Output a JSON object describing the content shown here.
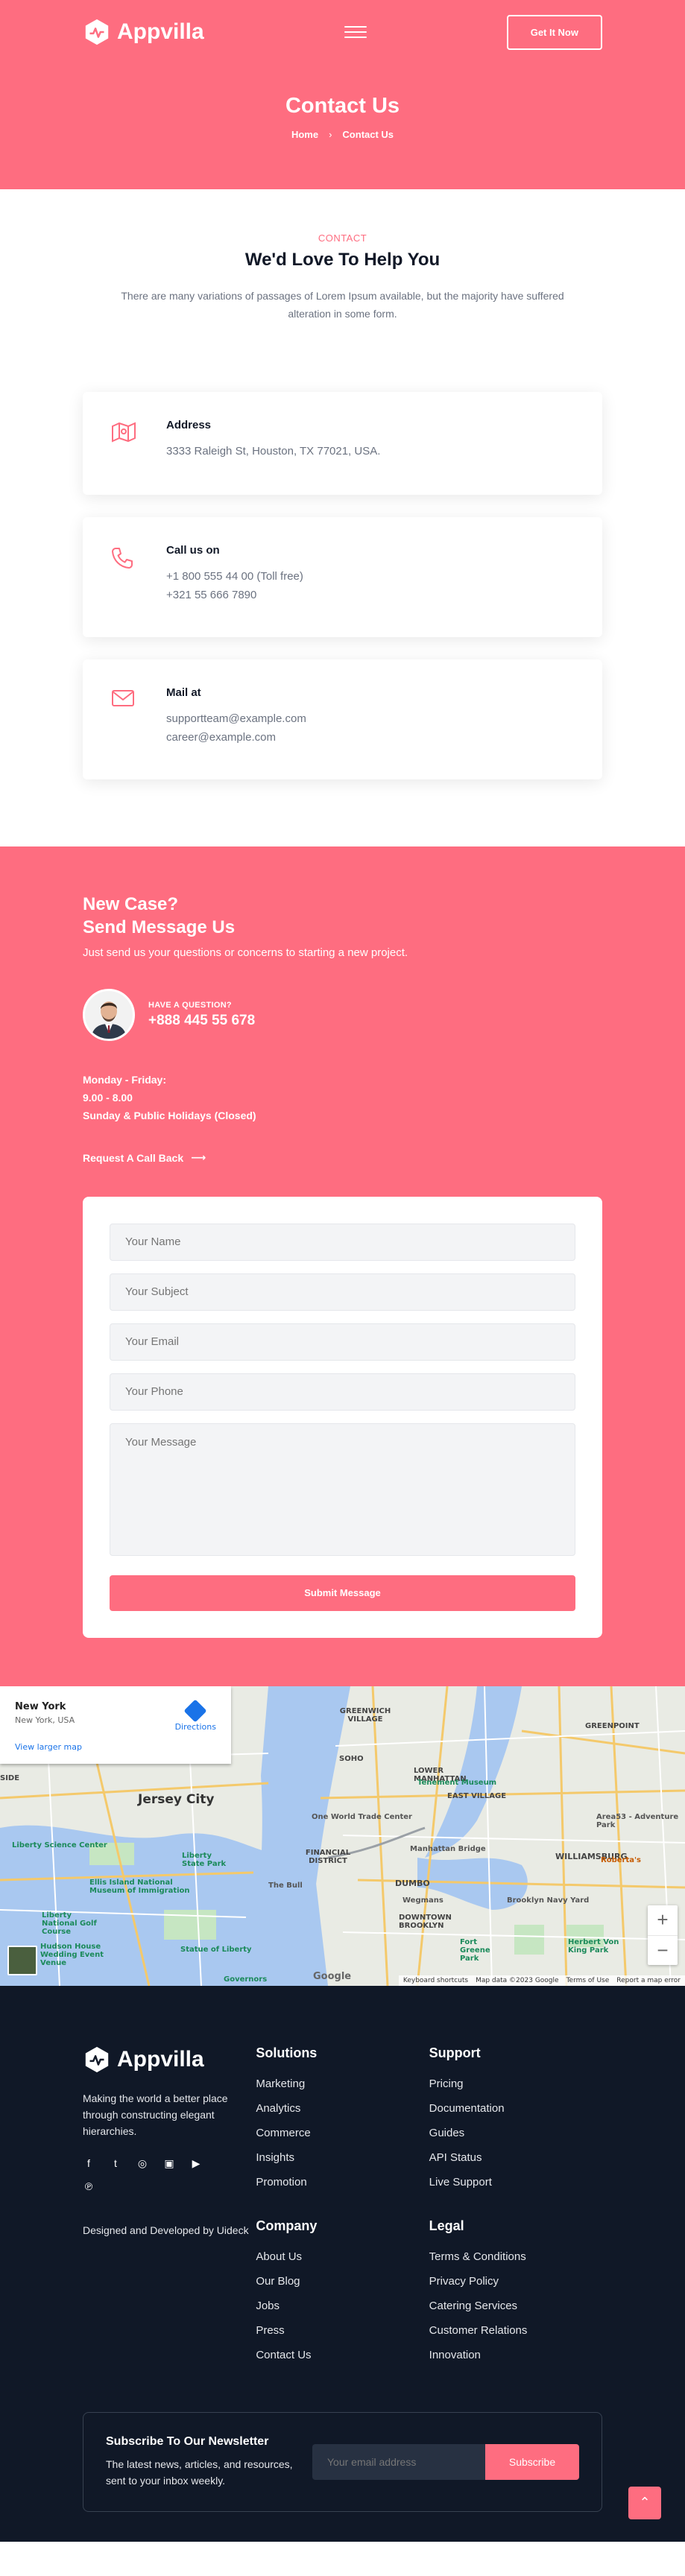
{
  "header": {
    "brand": "Appvilla",
    "cta": "Get It Now",
    "title": "Contact Us",
    "breadcrumb_home": "Home",
    "breadcrumb_separator": "›",
    "breadcrumb_current": "Contact Us"
  },
  "intro": {
    "tagline": "CONTACT",
    "heading": "We'd Love To Help You",
    "text": "There are many variations of passages of Lorem Ipsum available, but the majority have suffered alteration in some form."
  },
  "cards": [
    {
      "icon": "map-icon",
      "title": "Address",
      "lines": [
        "3333 Raleigh St, Houston, TX 77021, USA."
      ]
    },
    {
      "icon": "phone-icon",
      "title": "Call us on",
      "lines": [
        "+1 800 555 44 00 (Toll free)",
        "+321 55 666 7890"
      ]
    },
    {
      "icon": "mail-icon",
      "title": "Mail at",
      "lines": [
        "supportteam@example.com",
        "career@example.com"
      ]
    }
  ],
  "send": {
    "heading_line1": "New Case?",
    "heading_line2": "Send Message Us",
    "sub": "Just send us your questions or concerns to starting a new project.",
    "question_label": "HAVE A QUESTION?",
    "phone": "+888 445 55 678",
    "hours_1": "Monday - Friday:",
    "hours_2": "9.00 - 8.00",
    "hours_3": "Sunday & Public Holidays (Closed)",
    "callback": "Request A Call Back",
    "callback_arrow": "⟶"
  },
  "form": {
    "name_placeholder": "Your Name",
    "subject_placeholder": "Your Subject",
    "email_placeholder": "Your Email",
    "phone_placeholder": "Your Phone",
    "message_placeholder": "Your Message",
    "submit": "Submit Message"
  },
  "map": {
    "city": "New York",
    "address": "New York, USA",
    "directions": "Directions",
    "larger": "View larger map",
    "zoom_in": "+",
    "zoom_out": "−",
    "labels": {
      "jersey_city": "Jersey City",
      "east_village": "EAST VILLAGE",
      "greenwich_village": "GREENWICH VILLAGE",
      "soho": "SOHO",
      "lower_manhattan": "LOWER MANHATTAN",
      "financial": "FINANCIAL DISTRICT",
      "williamsburg": "WILLIAMSBURG",
      "greenpoint": "GREENPOINT",
      "dumbo": "DUMBO",
      "downtown_brooklyn": "DOWNTOWN BROOKLYN",
      "wtc": "One World Trade Center",
      "tenement": "Tenement Museum",
      "manhattan_bridge": "Manhattan Bridge",
      "liberty_sc": "Liberty Science Center",
      "liberty_park": "Liberty State Park",
      "ellis": "Ellis Island National Museum of Immigration",
      "statue": "Statue of Liberty",
      "brooklyn_navy": "Brooklyn Navy Yard",
      "fort_greene": "Fort Greene Park",
      "herbert": "Herbert Von King Park",
      "wegmans": "Wegmans",
      "area53": "Area53 - Adventure Park",
      "roberta": "Roberta's",
      "bull": "The Bull",
      "side": "SIDE",
      "hudson": "Hudson House Wedding Event Venue",
      "liberty_golf": "Liberty National Golf Course",
      "governors": "Governors",
      "google": "Google"
    },
    "footer_keyboard": "Keyboard shortcuts",
    "footer_data": "Map data ©2023 Google",
    "footer_terms": "Terms of Use",
    "footer_report": "Report a map error"
  },
  "footer": {
    "brand": "Appvilla",
    "desc": "Making the world a better place through constructing elegant hierarchies.",
    "credit": "Designed and Developed by Uideck",
    "solutions_title": "Solutions",
    "solutions": [
      "Marketing",
      "Analytics",
      "Commerce",
      "Insights",
      "Promotion"
    ],
    "support_title": "Support",
    "support": [
      "Pricing",
      "Documentation",
      "Guides",
      "API Status",
      "Live Support"
    ],
    "company_title": "Company",
    "company": [
      "About Us",
      "Our Blog",
      "Jobs",
      "Press",
      "Contact Us"
    ],
    "legal_title": "Legal",
    "legal": [
      "Terms & Conditions",
      "Privacy Policy",
      "Catering Services",
      "Customer Relations",
      "Innovation"
    ],
    "newsletter_title": "Subscribe To Our Newsletter",
    "newsletter_text": "The latest news, articles, and resources, sent to your inbox weekly.",
    "newsletter_placeholder": "Your email address",
    "subscribe": "Subscribe",
    "to_top": "⌃"
  },
  "colors": {
    "accent": "#fe6d80",
    "footer_bg": "#101827"
  }
}
